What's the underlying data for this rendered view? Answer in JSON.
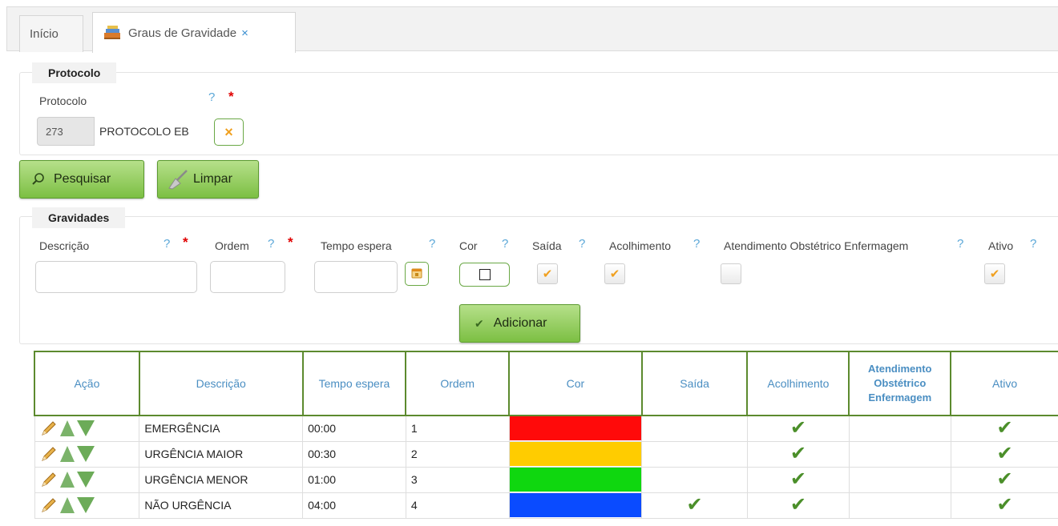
{
  "tabs": {
    "home_label": "Início",
    "active_label": "Graus de Gravidade",
    "close_symbol": "×"
  },
  "protocolo_section": {
    "legend": "Protocolo",
    "field_label": "Protocolo",
    "help_mark": "?",
    "required_mark": "*",
    "code_value": "273",
    "name_value": "PROTOCOLO EB",
    "clear_icon": "×"
  },
  "actions": {
    "search_label": "Pesquisar",
    "clear_label": "Limpar"
  },
  "gravidades_section": {
    "legend": "Gravidades",
    "fields": {
      "descricao_label": "Descrição",
      "ordem_label": "Ordem",
      "tempo_espera_label": "Tempo espera",
      "cor_label": "Cor",
      "saida_label": "Saída",
      "acolhimento_label": "Acolhimento",
      "atendimento_label": "Atendimento Obstétrico Enfermagem",
      "ativo_label": "Ativo"
    },
    "checks": {
      "saida": true,
      "acolhimento": true,
      "atendimento": false,
      "ativo": true
    },
    "check_mark": "✔",
    "add_label": "Adicionar"
  },
  "table": {
    "headers": {
      "acao": "Ação",
      "descricao": "Descrição",
      "tempo": "Tempo espera",
      "ordem": "Ordem",
      "cor": "Cor",
      "saida": "Saída",
      "acolhimento": "Acolhimento",
      "atendimento": "Atendimento Obstétrico Enfermagem",
      "ativo": "Ativo"
    },
    "tick": "✔",
    "rows": [
      {
        "descricao": "EMERGÊNCIA",
        "tempo": "00:00",
        "ordem": "1",
        "color": "#ff0a0a",
        "saida": false,
        "acolhimento": true,
        "atendimento": false,
        "ativo": true
      },
      {
        "descricao": "URGÊNCIA MAIOR",
        "tempo": "00:30",
        "ordem": "2",
        "color": "#ffcc00",
        "saida": false,
        "acolhimento": true,
        "atendimento": false,
        "ativo": true
      },
      {
        "descricao": "URGÊNCIA MENOR",
        "tempo": "01:00",
        "ordem": "3",
        "color": "#0fd70f",
        "saida": false,
        "acolhimento": true,
        "atendimento": false,
        "ativo": true
      },
      {
        "descricao": "NÃO URGÊNCIA",
        "tempo": "04:00",
        "ordem": "4",
        "color": "#0a4bff",
        "saida": true,
        "acolhimento": true,
        "atendimento": false,
        "ativo": true
      }
    ]
  }
}
